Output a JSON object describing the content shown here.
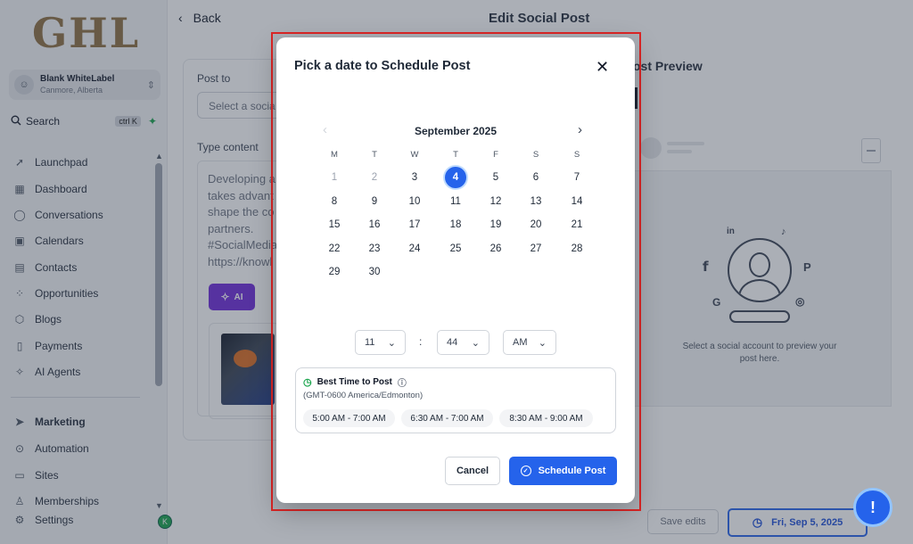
{
  "sidebar": {
    "logo": "GHL",
    "account": {
      "name": "Blank WhiteLabel",
      "location": "Canmore, Alberta"
    },
    "search": {
      "label": "Search",
      "shortcut": "ctrl K"
    },
    "items": [
      {
        "label": "Launchpad",
        "icon": "rocket-icon"
      },
      {
        "label": "Dashboard",
        "icon": "grid-icon"
      },
      {
        "label": "Conversations",
        "icon": "chat-icon"
      },
      {
        "label": "Calendars",
        "icon": "calendar-icon"
      },
      {
        "label": "Contacts",
        "icon": "contacts-icon"
      },
      {
        "label": "Opportunities",
        "icon": "opportunities-icon"
      },
      {
        "label": "Blogs",
        "icon": "cube-icon"
      },
      {
        "label": "Payments",
        "icon": "payments-icon"
      },
      {
        "label": "AI Agents",
        "icon": "sparkle-icon"
      },
      {
        "label": "Marketing",
        "icon": "send-icon"
      },
      {
        "label": "Automation",
        "icon": "automation-icon"
      },
      {
        "label": "Sites",
        "icon": "sites-icon"
      },
      {
        "label": "Memberships",
        "icon": "memberships-icon"
      },
      {
        "label": "Settings",
        "icon": "gear-icon"
      }
    ],
    "badge": "K"
  },
  "header": {
    "back_label": "Back",
    "title": "Edit Social Post"
  },
  "editor": {
    "post_to_label": "Post to",
    "select_placeholder": "Select a socia",
    "type_content_label": "Type content",
    "content_text": "Developing a\ntakes advant\nshape the co\npartners.\n#SocialMedia\nhttps://knowl",
    "ai_label": "AI"
  },
  "preview": {
    "title": "ost Preview",
    "caption": "Select a social account to preview your post here.",
    "social_icons": {
      "linkedin": "in",
      "tiktok": "♪",
      "facebook": "f",
      "pinterest": "P",
      "google": "G",
      "instagram": "◎"
    }
  },
  "footer": {
    "save_edits": "Save edits",
    "schedule_date": "Fri, Sep 5, 2025"
  },
  "modal": {
    "title": "Pick a date to Schedule Post",
    "close": "✕",
    "month_label": "September 2025",
    "weekdays": [
      "M",
      "T",
      "W",
      "T",
      "F",
      "S",
      "S"
    ],
    "weeks": [
      [
        "1",
        "2",
        "3",
        "4",
        "5",
        "6",
        "7"
      ],
      [
        "8",
        "9",
        "10",
        "11",
        "12",
        "13",
        "14"
      ],
      [
        "15",
        "16",
        "17",
        "18",
        "19",
        "20",
        "21"
      ],
      [
        "22",
        "23",
        "24",
        "25",
        "26",
        "27",
        "28"
      ],
      [
        "29",
        "30"
      ]
    ],
    "muted_days": [
      "1",
      "2"
    ],
    "selected_day": "4",
    "time": {
      "hour": "11",
      "minute": "44",
      "ampm": "AM",
      "separator": ":"
    },
    "best_time": {
      "title": "Best Time to Post",
      "timezone": "(GMT-0600 America/Edmonton)",
      "slots": [
        "5:00 AM - 7:00 AM",
        "6:30 AM - 7:00 AM",
        "8:30 AM - 9:00 AM"
      ]
    },
    "cancel_label": "Cancel",
    "schedule_label": "Schedule Post"
  },
  "colors": {
    "primary": "#2563eb",
    "ai_purple": "#6d28d9",
    "highlight_red": "#dc2626",
    "logo_gold": "#8c6d3f",
    "best_time_green": "#16a34a"
  }
}
